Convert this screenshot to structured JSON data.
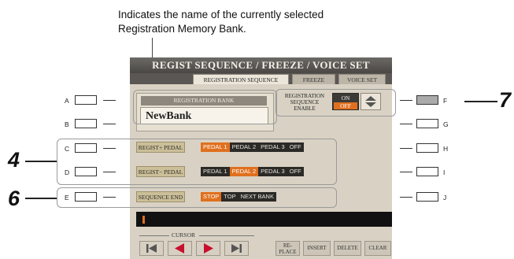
{
  "caption": {
    "line1": "Indicates the name of the currently selected",
    "line2": "Registration Memory Bank."
  },
  "screen": {
    "title": "REGIST SEQUENCE / FREEZE / VOICE SET",
    "tabs": [
      {
        "label": "REGISTRATION SEQUENCE",
        "active": true
      },
      {
        "label": "FREEZE",
        "active": false
      },
      {
        "label": "VOICE SET",
        "active": false
      }
    ],
    "bank": {
      "label": "REGISTRATION BANK",
      "name": "NewBank"
    },
    "sequence_enable": {
      "label_line1": "REGISTRATION",
      "label_line2": "SEQUENCE",
      "label_line3": "ENABLE",
      "on": "ON",
      "off": "OFF",
      "selected": "OFF"
    },
    "rows": [
      {
        "label": "REGIST+ PEDAL",
        "options": [
          "PEDAL 1",
          "PEDAL 2",
          "PEDAL 3",
          "OFF"
        ],
        "selected": "PEDAL 1"
      },
      {
        "label": "REGIST− PEDAL",
        "options": [
          "PEDAL 1",
          "PEDAL 2",
          "PEDAL 3",
          "OFF"
        ],
        "selected": "PEDAL 2"
      },
      {
        "label": "SEQUENCE END",
        "options": [
          "STOP",
          "TOP",
          "NEXT BANK"
        ],
        "selected": "STOP"
      }
    ],
    "cursor_label": "CURSOR",
    "actions": {
      "replace_line1": "RE-",
      "replace_line2": "PLACE",
      "insert": "INSERT",
      "delete": "DELETE",
      "clear": "CLEAR"
    }
  },
  "hardware_buttons": {
    "left": [
      "A",
      "B",
      "C",
      "D",
      "E"
    ],
    "right": [
      "F",
      "G",
      "H",
      "I",
      "J"
    ]
  },
  "callout_numbers": {
    "four": "4",
    "six": "6",
    "seven": "7"
  },
  "colors": {
    "accent": "#e0701f",
    "panel": "#d9d2c4",
    "title": "#5a5754"
  }
}
